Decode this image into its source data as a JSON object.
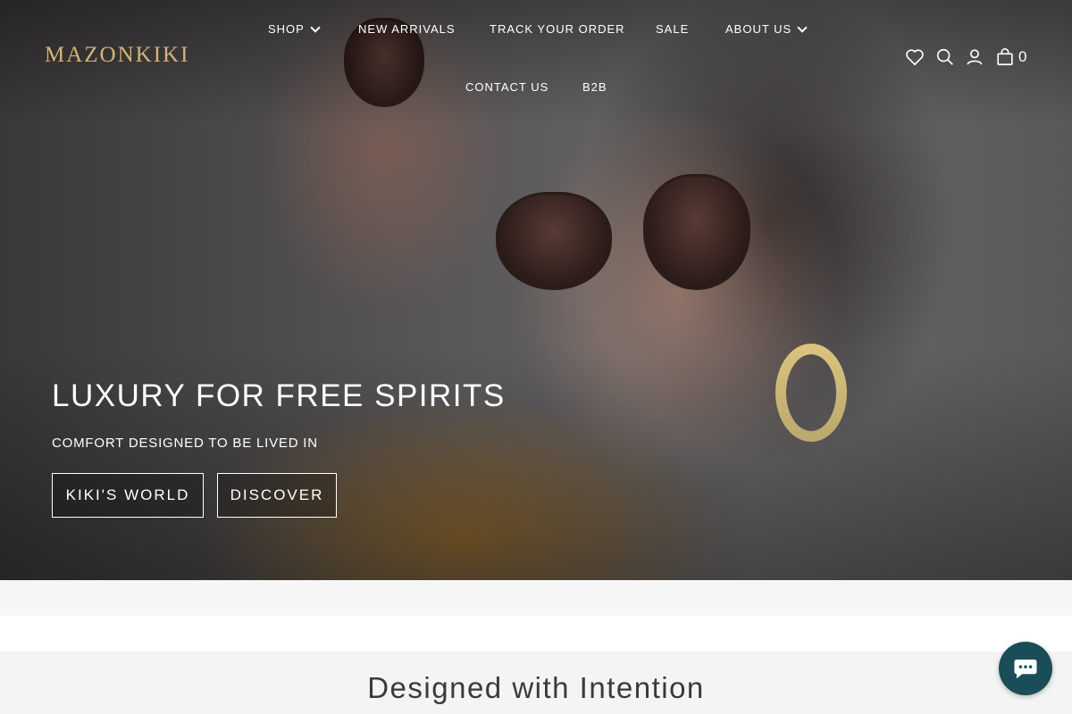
{
  "header": {
    "logo": "MAZONKIKI",
    "nav": [
      {
        "label": "SHOP",
        "dropdown": true
      },
      {
        "label": "NEW ARRIVALS"
      },
      {
        "label": "TRACK YOUR ORDER"
      },
      {
        "label": "SALE"
      },
      {
        "label": "ABOUT US",
        "dropdown": true
      },
      {
        "label": "CONTACT US"
      },
      {
        "label": "B2B"
      }
    ],
    "icons": [
      "heart-icon",
      "search-icon",
      "user-icon",
      "shopping-bag-icon"
    ],
    "cart_count": "0"
  },
  "hero": {
    "title": "LUXURY FOR FREE SPIRITS",
    "subtitle": "COMFORT DESIGNED TO BE LIVED IN",
    "buttons": [
      "KIKI'S WORLD",
      "DISCOVER"
    ]
  },
  "section": {
    "title": "Designed with Intention"
  },
  "chat": {
    "icon": "chat-bubble-icon"
  },
  "colors": {
    "logo": "#d7b377",
    "chat_button": "#1a4d57",
    "section_title": "#3a3a3a"
  }
}
